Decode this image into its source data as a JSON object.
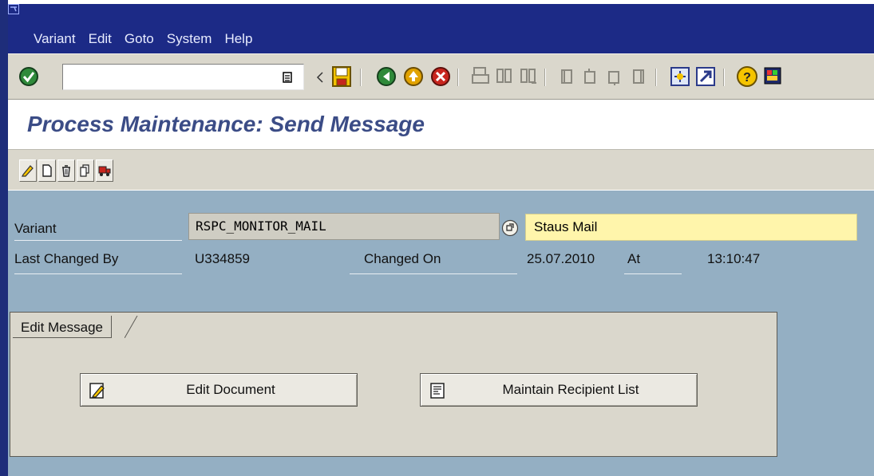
{
  "menu": {
    "items": [
      {
        "label": "Variant"
      },
      {
        "label": "Edit"
      },
      {
        "label": "Goto"
      },
      {
        "label": "System"
      },
      {
        "label": "Help"
      }
    ]
  },
  "toolbar": {
    "command_value": "",
    "icons": [
      "enter-icon",
      "save-icon",
      "back-icon",
      "exit-icon",
      "cancel-icon",
      "print-icon",
      "find-icon",
      "find-next-icon",
      "first-page-icon",
      "previous-page-icon",
      "next-page-icon",
      "last-page-icon",
      "create-session-icon",
      "shortcut-icon",
      "help-icon",
      "layout-menu-icon"
    ]
  },
  "title": "Process Maintenance: Send Message",
  "app_toolbar": {
    "icons": [
      "change-icon",
      "create-icon",
      "delete-icon",
      "copy-icon",
      "transport-icon"
    ]
  },
  "form": {
    "variant_label": "Variant",
    "variant_value": "RSPC_MONITOR_MAIL",
    "variant_description": "Staus Mail",
    "last_changed_by_label": "Last Changed By",
    "last_changed_by_value": "U334859",
    "changed_on_label": "Changed On",
    "changed_on_value": "25.07.2010",
    "at_label": "At",
    "at_value": "13:10:47"
  },
  "group": {
    "tab_label": "Edit Message",
    "edit_document_label": "Edit Document",
    "maintain_recipients_label": "Maintain Recipient List"
  },
  "colors": {
    "menubar": "#1c2a86",
    "toolbar": "#dad7cc",
    "title": "#3b4c86",
    "main_bg": "#94afc3",
    "description_bg": "#fff5ab"
  }
}
